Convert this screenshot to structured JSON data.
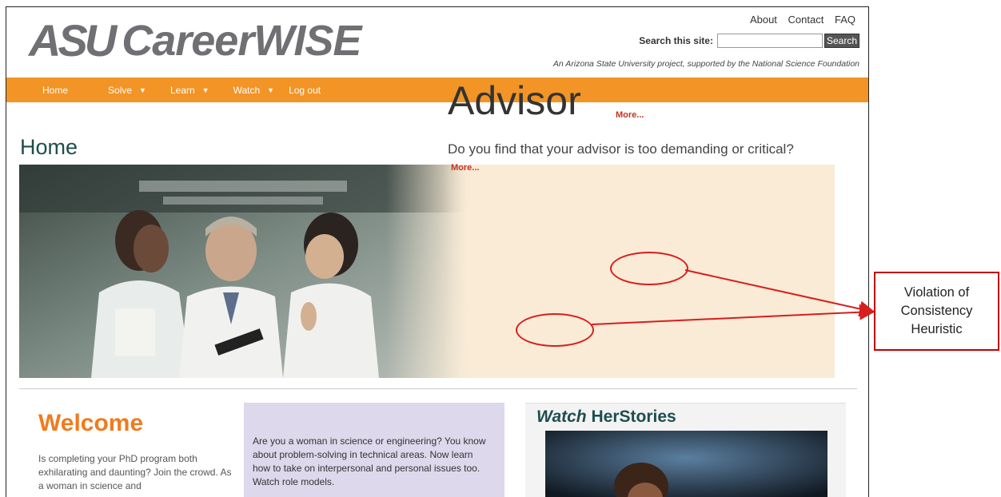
{
  "header": {
    "logo_asu": "ASU",
    "logo_name": "CareerWISE",
    "links": [
      "About",
      "Contact",
      "FAQ"
    ],
    "search_label": "Search this site:",
    "search_value": "",
    "search_button": "Search",
    "tagline": "An Arizona State University project, supported by the National Science Foundation"
  },
  "nav": {
    "items": [
      {
        "label": "Home",
        "has_dropdown": false
      },
      {
        "label": "Solve",
        "has_dropdown": true
      },
      {
        "label": "Learn",
        "has_dropdown": true
      },
      {
        "label": "Watch",
        "has_dropdown": true
      },
      {
        "label": "Log out",
        "has_dropdown": false
      }
    ],
    "dropdown_glyph": "▼",
    "color": "#f29426"
  },
  "page": {
    "title": "Home"
  },
  "hero": {
    "title": "Advisor",
    "more_link_1": "More...",
    "text": "Do you find that your advisor is too demanding or critical?",
    "more_link_2": "More..."
  },
  "welcome": {
    "heading": "Welcome",
    "text": "Is completing your PhD program both exhilarating and daunting? Join the crowd. As a woman in science and"
  },
  "intro": {
    "text": "Are you a woman in science or engineering? You know about problem-solving in technical areas. Now learn how to take on interpersonal and personal issues too. Watch role models."
  },
  "watch": {
    "heading_italic": "Watch",
    "heading_rest": "HerStories"
  },
  "annotation": {
    "text": "Violation of Consistency Heuristic",
    "color": "#d81e1e"
  }
}
